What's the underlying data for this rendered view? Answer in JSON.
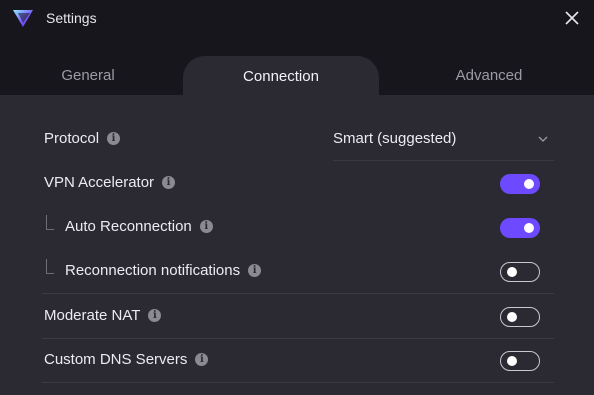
{
  "window": {
    "title": "Settings"
  },
  "tabs": [
    {
      "label": "General",
      "active": false
    },
    {
      "label": "Connection",
      "active": true
    },
    {
      "label": "Advanced",
      "active": false
    }
  ],
  "settings": {
    "protocol": {
      "label": "Protocol",
      "value": "Smart (suggested)"
    },
    "vpn_accelerator": {
      "label": "VPN Accelerator",
      "enabled": true
    },
    "auto_reconnection": {
      "label": "Auto Reconnection",
      "enabled": true
    },
    "reconnection_notifications": {
      "label": "Reconnection notifications",
      "enabled": false
    },
    "moderate_nat": {
      "label": "Moderate NAT",
      "enabled": false
    },
    "custom_dns": {
      "label": "Custom DNS Servers",
      "enabled": false
    }
  },
  "colors": {
    "accent": "#6d4aff",
    "background": "#2b2a33",
    "titlebar": "#17161c"
  },
  "icons": {
    "logo": "proton-vpn-logo",
    "close": "close-icon",
    "info": "info-icon",
    "dropdown": "chevron-down-icon"
  }
}
